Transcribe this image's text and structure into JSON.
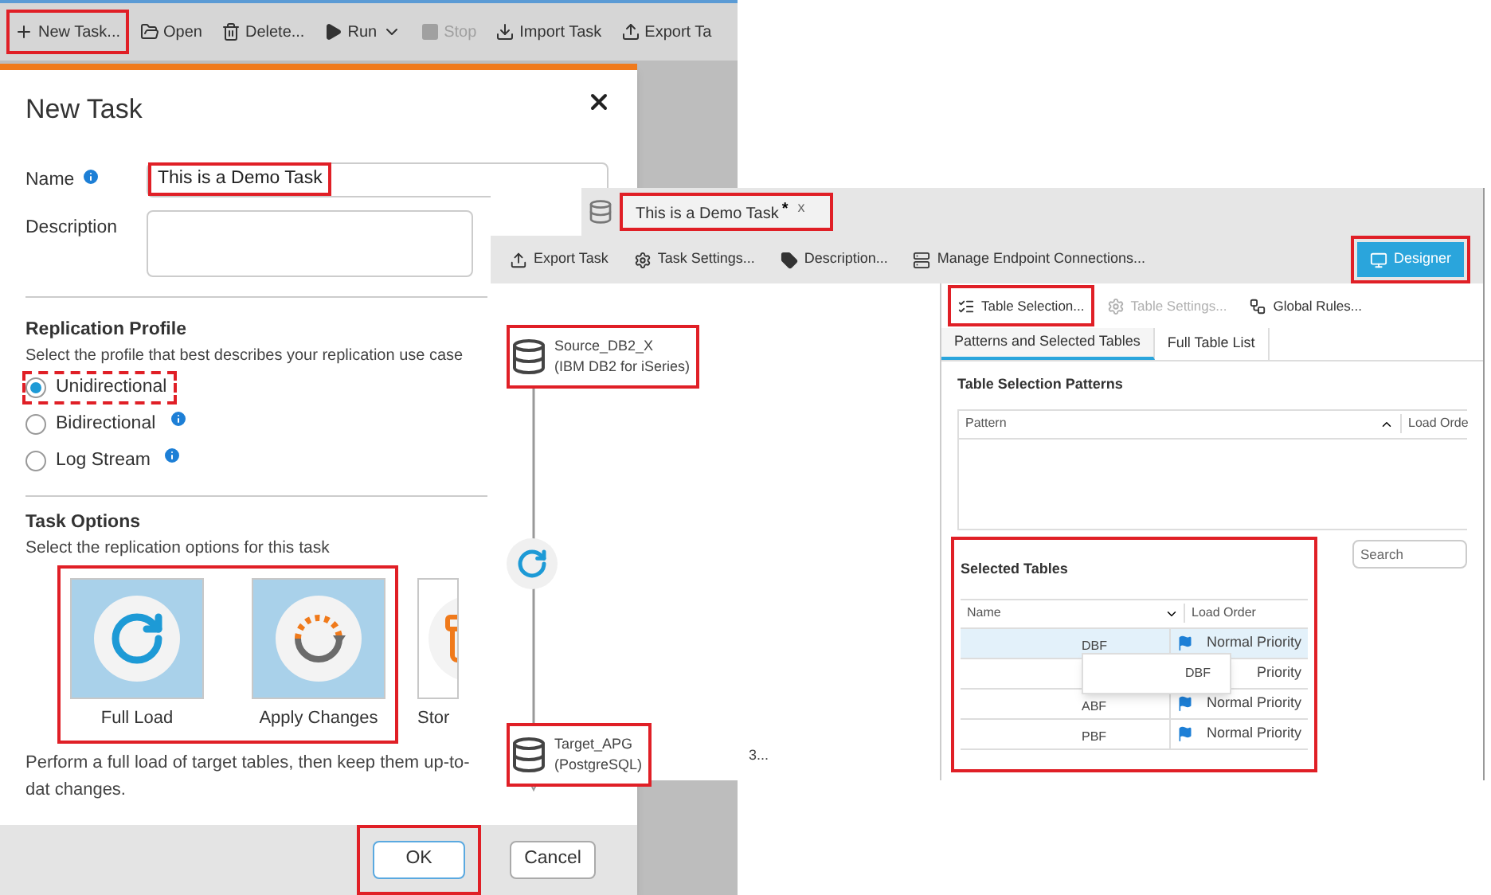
{
  "main_toolbar": {
    "items": [
      {
        "kind": "plus",
        "label": "New Task...",
        "disabled": false,
        "highlighted": true
      },
      {
        "kind": "folder",
        "label": "Open",
        "disabled": false,
        "highlighted": false
      },
      {
        "kind": "trash",
        "label": "Delete...",
        "disabled": false,
        "highlighted": false
      },
      {
        "kind": "play",
        "label": "Run",
        "disabled": false,
        "highlighted": false,
        "dropdown": true
      },
      {
        "kind": "stop",
        "label": "Stop",
        "disabled": true,
        "highlighted": false
      },
      {
        "kind": "import",
        "label": "Import Task",
        "disabled": false,
        "highlighted": false
      },
      {
        "kind": "export",
        "label": "Export Ta",
        "disabled": false,
        "highlighted": false
      }
    ]
  },
  "dialog": {
    "title": "New Task",
    "fields": [
      {
        "kind": "input",
        "label": "Name",
        "info": true,
        "value": "This is a Demo Task",
        "highlighted": true
      },
      {
        "kind": "textarea",
        "label": "Description",
        "info": false
      }
    ],
    "replication_profile": {
      "heading": "Replication Profile",
      "hint": "Select the profile that best describes your replication use case",
      "options": [
        {
          "label": "Unidirectional",
          "selected": true,
          "info": false,
          "highlighted": true
        },
        {
          "label": "Bidirectional",
          "selected": false,
          "info": true,
          "highlighted": false
        },
        {
          "label": "Log Stream",
          "selected": false,
          "info": true,
          "highlighted": false
        }
      ]
    },
    "task_options": {
      "heading": "Task Options",
      "hint": "Select the replication options for this task",
      "options": [
        {
          "kind": "full_load",
          "label": "Full Load",
          "selected": true,
          "highlighted": true
        },
        {
          "kind": "apply_changes",
          "label": "Apply Changes",
          "selected": true,
          "highlighted": true
        },
        {
          "kind": "store",
          "label": "Stor",
          "selected": false,
          "highlighted": false
        }
      ],
      "description": "Perform a full load of target tables, then keep them up-to-dat changes."
    },
    "buttons": [
      {
        "label": "OK",
        "primary": true,
        "highlighted": true
      },
      {
        "label": "Cancel",
        "primary": false,
        "highlighted": false
      }
    ]
  },
  "task_window": {
    "tab": {
      "label": "This is a Demo Task",
      "modified": "*",
      "close": "x",
      "highlighted": true
    },
    "toolbar": [
      {
        "kind": "export",
        "label": "Export Task"
      },
      {
        "kind": "gear",
        "label": "Task Settings..."
      },
      {
        "kind": "tag",
        "label": "Description..."
      },
      {
        "kind": "endpoint",
        "label": "Manage Endpoint Connections..."
      }
    ],
    "designer_button": {
      "label": "Designer",
      "selected": true,
      "highlighted": true
    },
    "diagram": {
      "source": {
        "name": "Source_DB2_X",
        "type": "(IBM DB2 for iSeries)",
        "highlighted": true
      },
      "target": {
        "name": "Target_APG",
        "type": "(PostgreSQL)",
        "highlighted": true
      },
      "extra": "3..."
    },
    "table_toolbar": [
      {
        "kind": "table",
        "label": "Table Selection...",
        "disabled": false,
        "highlighted": true
      },
      {
        "kind": "gear",
        "label": "Table Settings...",
        "disabled": true,
        "highlighted": false
      },
      {
        "kind": "rules",
        "label": "Global Rules...",
        "disabled": false,
        "highlighted": false
      }
    ],
    "tabs": [
      {
        "label": "Patterns and Selected Tables",
        "selected": true
      },
      {
        "label": "Full Table List",
        "selected": false
      }
    ],
    "patterns": {
      "heading": "Table Selection Patterns",
      "columns": [
        "Pattern",
        "Load Orde"
      ]
    },
    "selected_tables": {
      "heading": "Selected Tables",
      "search": {
        "placeholder": "Search"
      },
      "columns": [
        "Name",
        "Load Order"
      ],
      "highlighted": true,
      "rows": [
        {
          "name": "DBF",
          "load_order": "Normal Priority",
          "selected": true,
          "flag": true
        },
        {
          "load_order": "Priority",
          "selected": false,
          "flag": false
        },
        {
          "name": "ABF",
          "load_order": "Normal Priority",
          "selected": false,
          "flag": true
        },
        {
          "name": "PBF",
          "load_order": "Normal Priority",
          "selected": false,
          "flag": true
        }
      ],
      "popup": "DBF"
    }
  }
}
